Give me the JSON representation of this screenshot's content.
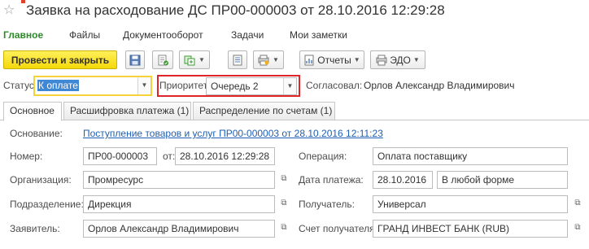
{
  "header": {
    "title": "Заявка на расходование ДС ПР00-000003 от 28.10.2016 12:29:28",
    "favorite_icon": "star-icon"
  },
  "menu": {
    "items": [
      "Главное",
      "Файлы",
      "Документооборот",
      "Задачи",
      "Мои заметки"
    ],
    "active_color": "#2d8b2a"
  },
  "toolbar": {
    "post_close_label": "Провести и закрыть",
    "reports_label": "Отчеты",
    "edo_label": "ЭДО",
    "primary_color": "#f5d80a"
  },
  "status_row": {
    "status_label": "Статус:",
    "status_value": "К оплате",
    "priority_label": "Приоритет:",
    "priority_value": "Очередь 2",
    "approved_label": "Согласовал:",
    "approved_value": "Орлов Александр Владимирович",
    "highlight_color": "#e0252a"
  },
  "tabs": [
    "Основное",
    "Расшифровка платежа (1)",
    "Распределение по счетам (1)"
  ],
  "form": {
    "basis_label": "Основание:",
    "basis_value": "Поступление товаров и услуг ПР00-000003 от 28.10.2016 12:11:23",
    "number_label": "Номер:",
    "number_value": "ПР00-000003",
    "from_label": "от:",
    "from_value": "28.10.2016 12:29:28",
    "operation_label": "Операция:",
    "operation_value": "Оплата поставщику",
    "org_label": "Организация:",
    "org_value": "Промресурс",
    "pay_date_label": "Дата платежа:",
    "pay_date_value": "28.10.2016",
    "pay_form_value": "В любой форме",
    "dept_label": "Подразделение:",
    "dept_value": "Дирекция",
    "recipient_label": "Получатель:",
    "recipient_value": "Универсал",
    "applicant_label": "Заявитель:",
    "applicant_value": "Орлов Александр Владимирович",
    "recipient_account_label": "Счет получателя:",
    "recipient_account_value": "ГРАНД ИНВЕСТ БАНК (RUB)"
  }
}
